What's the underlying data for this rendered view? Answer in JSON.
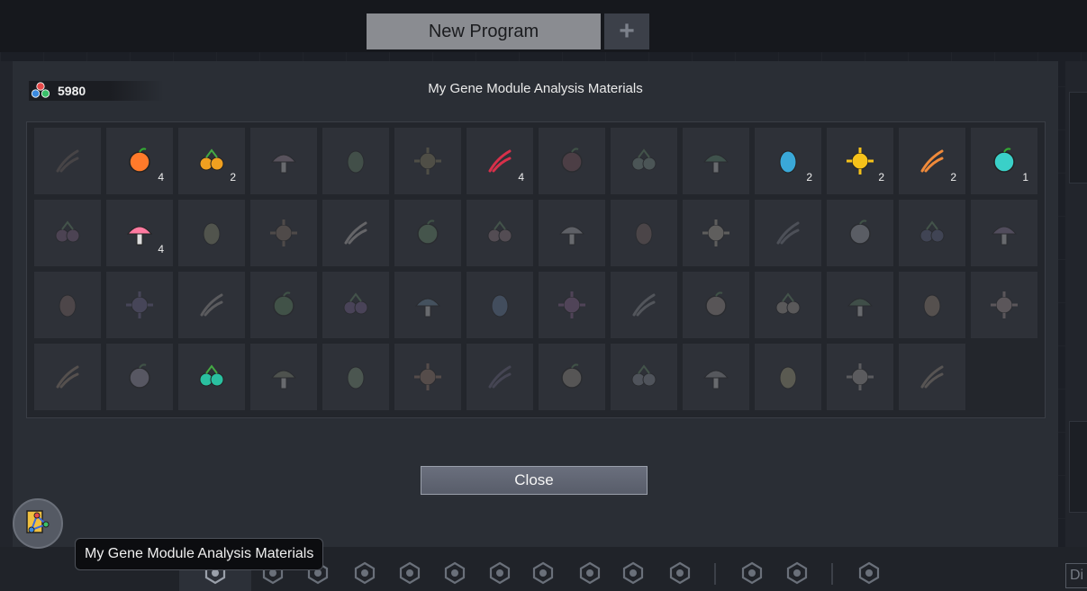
{
  "tabs": {
    "active_label": "New Program",
    "add_label": "+"
  },
  "dialog": {
    "title": "My Gene Module Analysis Materials",
    "currency_value": "5980",
    "close_label": "Close"
  },
  "materials": [
    {
      "icon": "claw-icon",
      "color": "#8a6a55",
      "owned": false,
      "count": ""
    },
    {
      "icon": "fruit-icon",
      "color": "#ff7a2a",
      "owned": true,
      "count": "4"
    },
    {
      "icon": "berries-icon",
      "color": "#f0a020",
      "owned": true,
      "count": "2"
    },
    {
      "icon": "mushroom-icon",
      "color": "#c58fb0",
      "owned": false,
      "count": ""
    },
    {
      "icon": "egg-icon",
      "color": "#4a9a4a",
      "owned": false,
      "count": ""
    },
    {
      "icon": "spore-icon",
      "color": "#a08a30",
      "owned": false,
      "count": ""
    },
    {
      "icon": "tentacle-icon",
      "color": "#d8304a",
      "owned": true,
      "count": "4"
    },
    {
      "icon": "spiky-ball-icon",
      "color": "#c04a5a",
      "owned": false,
      "count": ""
    },
    {
      "icon": "swirl-icon",
      "color": "#6aaa8a",
      "owned": false,
      "count": ""
    },
    {
      "icon": "leaf-pod-icon",
      "color": "#2aaa5a",
      "owned": false,
      "count": ""
    },
    {
      "icon": "blue-shell-icon",
      "color": "#3aa8d8",
      "owned": true,
      "count": "2"
    },
    {
      "icon": "golden-apple-icon",
      "color": "#f6c21a",
      "owned": true,
      "count": "2"
    },
    {
      "icon": "seed-pod-icon",
      "color": "#f08a3a",
      "owned": true,
      "count": "2"
    },
    {
      "icon": "coral-icon",
      "color": "#3ad0c8",
      "owned": true,
      "count": "1"
    },
    {
      "icon": "flower-icon",
      "color": "#b05ab0",
      "owned": false,
      "count": ""
    },
    {
      "icon": "pink-orb-icon",
      "color": "#ff7aa0",
      "owned": true,
      "count": "4"
    },
    {
      "icon": "mossy-rock-icon",
      "color": "#9aa24a",
      "owned": false,
      "count": ""
    },
    {
      "icon": "bread-icon",
      "color": "#b07a4a",
      "owned": false,
      "count": ""
    },
    {
      "icon": "fang-icon",
      "color": "#d8d0c0",
      "owned": false,
      "count": ""
    },
    {
      "icon": "sprout-icon",
      "color": "#4ab04a",
      "owned": false,
      "count": ""
    },
    {
      "icon": "curl-icon",
      "color": "#c07a8a",
      "owned": false,
      "count": ""
    },
    {
      "icon": "skull-icon",
      "color": "#c0c0c8",
      "owned": false,
      "count": ""
    },
    {
      "icon": "jaw-icon",
      "color": "#a06a5a",
      "owned": false,
      "count": ""
    },
    {
      "icon": "tooth-icon",
      "color": "#d0b890",
      "owned": false,
      "count": ""
    },
    {
      "icon": "crystal-icon",
      "color": "#8a90a8",
      "owned": false,
      "count": ""
    },
    {
      "icon": "brain-icon",
      "color": "#b0b8c8",
      "owned": false,
      "count": ""
    },
    {
      "icon": "fish-tail-icon",
      "color": "#5a6ac0",
      "owned": false,
      "count": ""
    },
    {
      "icon": "feather-icon",
      "color": "#b07ad0",
      "owned": false,
      "count": ""
    },
    {
      "icon": "horn-icon",
      "color": "#b06a5a",
      "owned": false,
      "count": ""
    },
    {
      "icon": "purple-scale-icon",
      "color": "#7a6ad0",
      "owned": false,
      "count": ""
    },
    {
      "icon": "bone-icon",
      "color": "#c0b0a0",
      "owned": false,
      "count": ""
    },
    {
      "icon": "green-berry-icon",
      "color": "#3aaa3a",
      "owned": false,
      "count": ""
    },
    {
      "icon": "violet-shell-icon",
      "color": "#9a5ad8",
      "owned": false,
      "count": ""
    },
    {
      "icon": "blue-fish-icon",
      "color": "#4a9ad8",
      "owned": false,
      "count": ""
    },
    {
      "icon": "blue-feather-icon",
      "color": "#4a8ae0",
      "owned": false,
      "count": ""
    },
    {
      "icon": "violet-flame-icon",
      "color": "#c05ad0",
      "owned": false,
      "count": ""
    },
    {
      "icon": "roots-icon",
      "color": "#9aa0a8",
      "owned": false,
      "count": ""
    },
    {
      "icon": "stone-chip-icon",
      "color": "#c09a8a",
      "owned": false,
      "count": ""
    },
    {
      "icon": "talon-icon",
      "color": "#c0a890",
      "owned": false,
      "count": ""
    },
    {
      "icon": "green-bulb-icon",
      "color": "#3a9a4a",
      "owned": false,
      "count": ""
    },
    {
      "icon": "totem-icon",
      "color": "#c08a5a",
      "owned": false,
      "count": ""
    },
    {
      "icon": "conch-icon",
      "color": "#d09a9a",
      "owned": false,
      "count": ""
    },
    {
      "icon": "flat-stone-icon",
      "color": "#c08a5a",
      "owned": false,
      "count": ""
    },
    {
      "icon": "worm-icon",
      "color": "#b0a0d0",
      "owned": false,
      "count": ""
    },
    {
      "icon": "jelly-icon",
      "color": "#2ac0a0",
      "owned": true,
      "count": ""
    },
    {
      "icon": "moss-clump-icon",
      "color": "#8a9a5a",
      "owned": false,
      "count": ""
    },
    {
      "icon": "twig-icon",
      "color": "#6ab05a",
      "owned": false,
      "count": ""
    },
    {
      "icon": "red-rock-icon",
      "color": "#d07a4a",
      "owned": false,
      "count": ""
    },
    {
      "icon": "cloud-stone-icon",
      "color": "#7a6ab0",
      "owned": false,
      "count": ""
    },
    {
      "icon": "ore-icon",
      "color": "#b0a07a",
      "owned": false,
      "count": ""
    },
    {
      "icon": "cog-stone-icon",
      "color": "#8a9ab0",
      "owned": false,
      "count": ""
    },
    {
      "icon": "gray-ore-icon",
      "color": "#a8a8a8",
      "owned": false,
      "count": ""
    },
    {
      "icon": "gold-ore-icon",
      "color": "#c0b04a",
      "owned": false,
      "count": ""
    },
    {
      "icon": "pale-ore-icon",
      "color": "#c0b0a0",
      "owned": false,
      "count": ""
    },
    {
      "icon": "amber-ore-icon",
      "color": "#c09a6a",
      "owned": false,
      "count": ""
    }
  ],
  "float_button": {
    "icon": "gene-map-icon"
  },
  "tooltip": {
    "text": "My Gene Module Analysis Materials"
  },
  "bottom_nav": [
    "gene-analysis-icon",
    "wing-icon",
    "creature-icon",
    "shield-wings-icon",
    "crosshair-icon",
    "mask-icon",
    "swords-icon",
    "dragon-icon",
    "paw-icon",
    "puzzle-icon",
    "group-icon",
    "hex-gem-icon",
    "hex-gem-alt-icon",
    "tally-icon"
  ],
  "bottom_nav_right_label": "Di"
}
